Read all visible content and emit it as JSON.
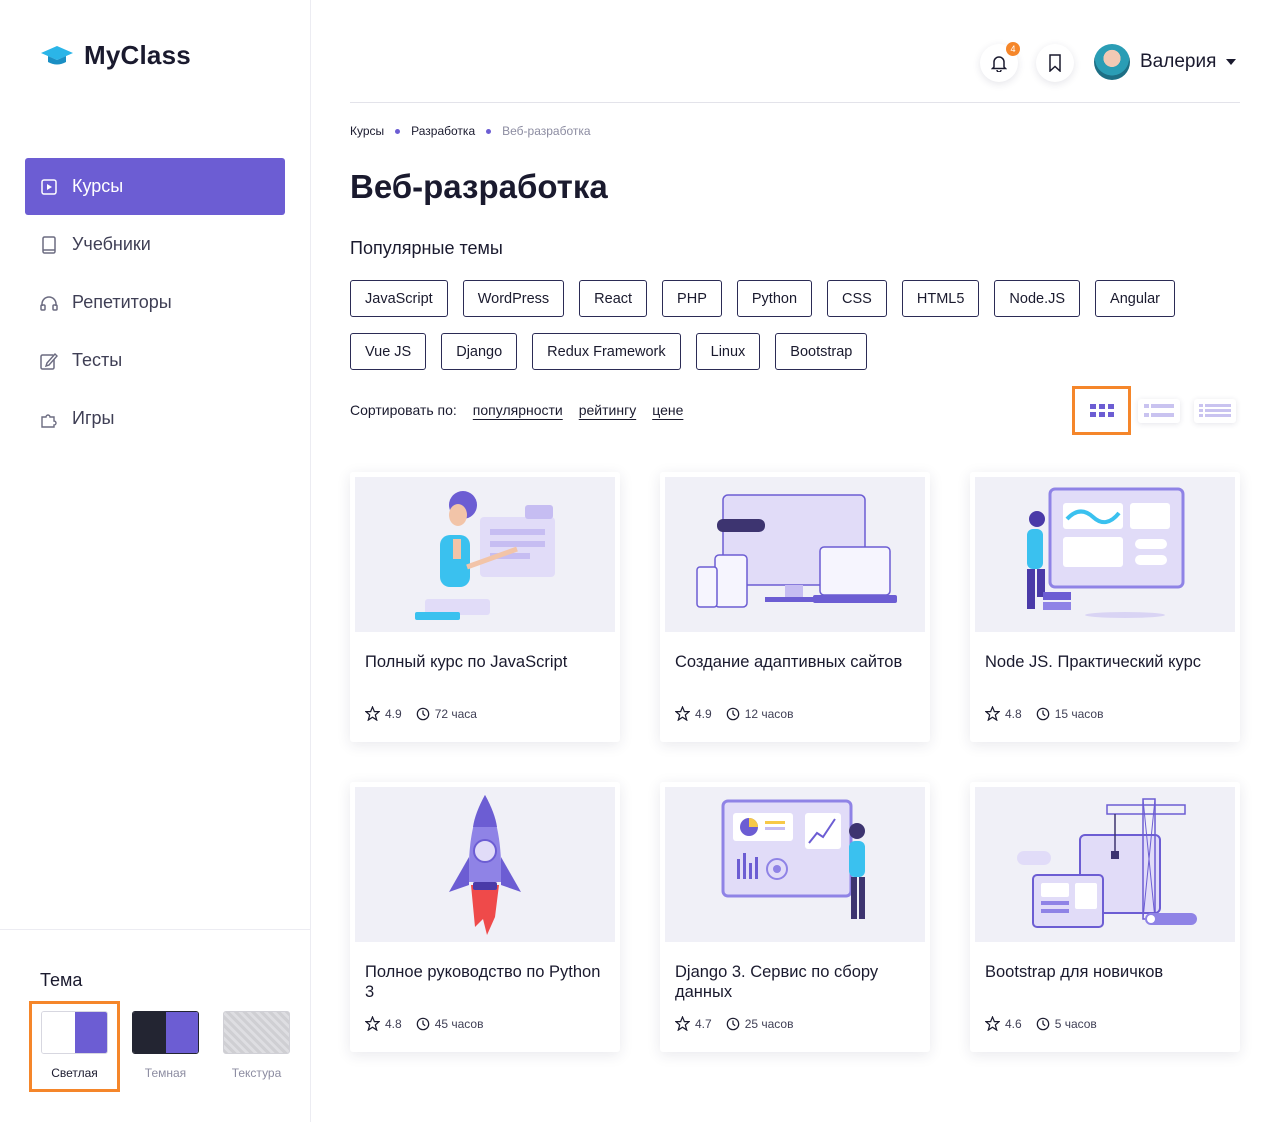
{
  "app": {
    "name": "MyClass"
  },
  "sidebar": {
    "items": [
      {
        "label": "Курсы",
        "icon": "play-square-icon",
        "active": true
      },
      {
        "label": "Учебники",
        "icon": "book-icon",
        "active": false
      },
      {
        "label": "Репетиторы",
        "icon": "headphones-icon",
        "active": false
      },
      {
        "label": "Тесты",
        "icon": "edit-icon",
        "active": false
      },
      {
        "label": "Игры",
        "icon": "puzzle-icon",
        "active": false
      }
    ],
    "theme": {
      "title": "Тема",
      "options": [
        {
          "label": "Светлая",
          "selected": true,
          "left": "#ffffff",
          "right": "#6c5dd3"
        },
        {
          "label": "Темная",
          "selected": false,
          "left": "#232532",
          "right": "#6c5dd3"
        },
        {
          "label": "Текстура",
          "selected": false,
          "left": "#cfcfd3",
          "right": "#cfcfd3"
        }
      ]
    }
  },
  "header": {
    "notifications_count": "4",
    "user_name": "Валерия"
  },
  "breadcrumb": [
    "Курсы",
    "Разработка",
    "Веб-разработка"
  ],
  "page_title": "Веб-разработка",
  "popular": {
    "title": "Популярные темы",
    "tags": [
      "JavaScript",
      "WordPress",
      "React",
      "PHP",
      "Python",
      "CSS",
      "HTML5",
      "Node.JS",
      "Angular",
      "Vue JS",
      "Django",
      "Redux Framework",
      "Linux",
      "Bootstrap"
    ]
  },
  "sort": {
    "label": "Сортировать по:",
    "options": [
      "популярности",
      "рейтингу",
      "цене"
    ]
  },
  "view_modes": [
    "grid",
    "list",
    "compact-list"
  ],
  "courses": [
    {
      "title": "Полный курс по JavaScript",
      "rating": "4.9",
      "duration": "72 часа"
    },
    {
      "title": "Создание адаптивных сайтов",
      "rating": "4.9",
      "duration": "12 часов"
    },
    {
      "title": "Node JS. Практический курс",
      "rating": "4.8",
      "duration": "15 часов"
    },
    {
      "title": "Полное руководство по Python 3",
      "rating": "4.8",
      "duration": "45 часов"
    },
    {
      "title": "Django 3. Сервис по сбору данных",
      "rating": "4.7",
      "duration": "25 часов"
    },
    {
      "title": "Bootstrap для новичков",
      "rating": "4.6",
      "duration": "5 часов"
    }
  ],
  "colors": {
    "accent": "#6c5dd3",
    "highlight": "#f5862a",
    "text": "#1a1a2e"
  }
}
